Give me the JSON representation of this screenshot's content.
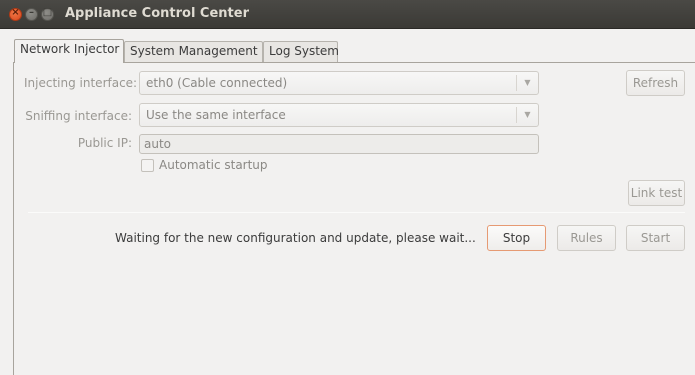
{
  "window": {
    "title": "Appliance Control Center",
    "controls": {
      "close": "×",
      "minimize": "–",
      "maximize": "□"
    }
  },
  "tabs": [
    {
      "label": "Network Injector",
      "active": true
    },
    {
      "label": "System Management",
      "active": false
    },
    {
      "label": "Log System",
      "active": false
    }
  ],
  "form": {
    "injecting_label": "Injecting interface:",
    "injecting_value": "eth0 (Cable connected)",
    "sniffing_label": "Sniffing interface:",
    "sniffing_value": "Use the same interface",
    "public_ip_label": "Public IP:",
    "public_ip_value": "auto",
    "autostart_label": "Automatic startup",
    "autostart_checked": false
  },
  "buttons": {
    "refresh": "Refresh",
    "link_test": "Link test",
    "stop": "Stop",
    "rules": "Rules",
    "start": "Start"
  },
  "status_text": "Waiting for the new configuration and update, please wait...",
  "icons": {
    "dropdown_arrow": "▼"
  },
  "colors": {
    "titlebar": "#3c3b37",
    "close_button": "#e25a2b",
    "focus_border": "#e69a73"
  }
}
